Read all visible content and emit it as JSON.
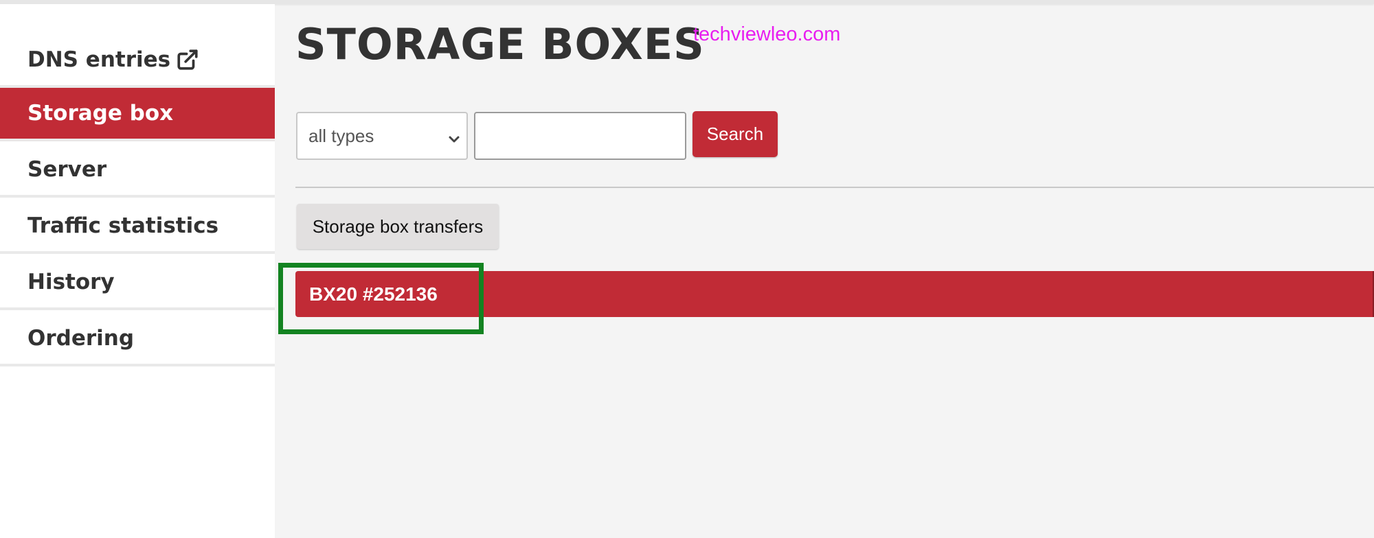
{
  "sidebar": {
    "items": [
      {
        "label": "DNS entries",
        "active": false,
        "external": true
      },
      {
        "label": "Storage box",
        "active": true,
        "external": false
      },
      {
        "label": "Server",
        "active": false,
        "external": false
      },
      {
        "label": "Traffic statistics",
        "active": false,
        "external": false
      },
      {
        "label": "History",
        "active": false,
        "external": false
      },
      {
        "label": "Ordering",
        "active": false,
        "external": false
      }
    ]
  },
  "main": {
    "title": "STORAGE BOXES",
    "watermark": "techviewleo.com",
    "filter": {
      "selected": "all types",
      "search_value": ""
    },
    "search_label": "Search",
    "transfers_label": "Storage box transfers",
    "boxes": [
      {
        "label": "BX20 #252136",
        "highlighted": true
      }
    ]
  },
  "colors": {
    "accent": "#c12b36",
    "highlight": "#138321",
    "watermark": "#e81ef0"
  },
  "icons": {
    "external": "external-link-icon",
    "select": "chevron-down-icon"
  }
}
